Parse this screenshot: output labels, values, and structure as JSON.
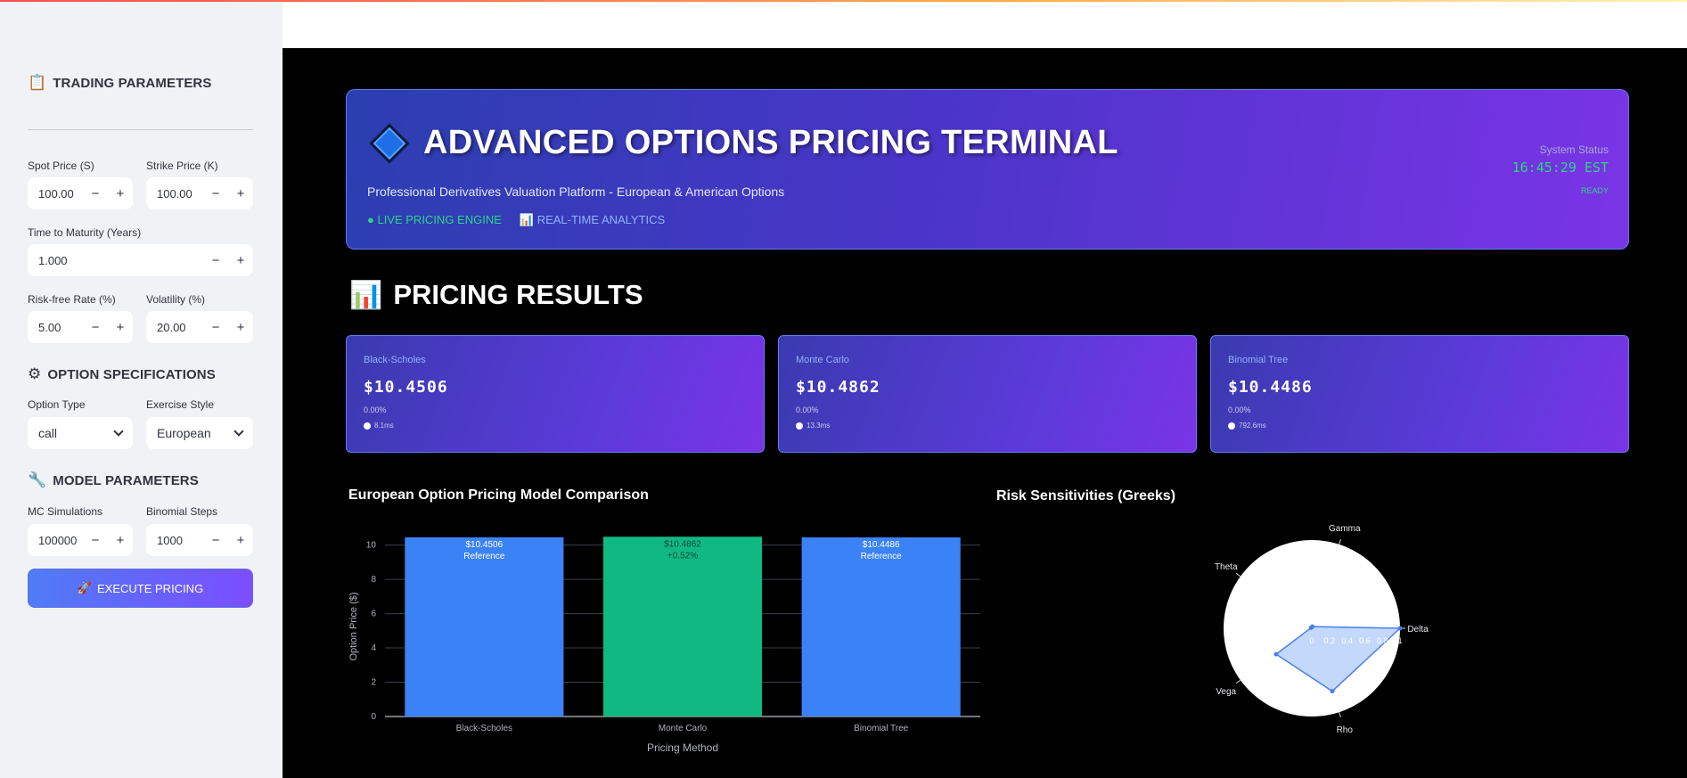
{
  "sidebar": {
    "trading_header": "TRADING PARAMETERS",
    "trading_icon": "clipboard-icon",
    "spot_label": "Spot Price (S)",
    "spot_value": "100.00",
    "strike_label": "Strike Price (K)",
    "strike_value": "100.00",
    "maturity_label": "Time to Maturity (Years)",
    "maturity_value": "1.000",
    "rate_label": "Risk-free Rate (%)",
    "rate_value": "5.00",
    "vol_label": "Volatility (%)",
    "vol_value": "20.00",
    "option_spec_header": "OPTION SPECIFICATIONS",
    "option_spec_icon": "gear-icon",
    "option_type_label": "Option Type",
    "option_type_value": "call",
    "exercise_label": "Exercise Style",
    "exercise_value": "European",
    "model_header": "MODEL PARAMETERS",
    "model_icon": "wrench-icon",
    "mc_label": "MC Simulations",
    "mc_value": "100000",
    "binom_label": "Binomial Steps",
    "binom_value": "1000",
    "minus": "−",
    "plus": "+",
    "execute_label": "EXECUTE PRICING",
    "execute_icon": "rocket-icon"
  },
  "hero": {
    "title": "ADVANCED OPTIONS PRICING TERMINAL",
    "subtitle": "Professional Derivatives Valuation Platform - European & American Options",
    "tag_live": "● LIVE PRICING ENGINE",
    "tag_analytics": "REAL-TIME ANALYTICS",
    "status_label": "System Status",
    "status_time": "16:45:29 EST",
    "status_state": "READY"
  },
  "results": {
    "title": "PRICING RESULTS",
    "cards": [
      {
        "name": "Black-Scholes",
        "price": "$10.4506",
        "pct": "0.00%",
        "time": "8.1ms"
      },
      {
        "name": "Monte Carlo",
        "price": "$10.4862",
        "pct": "0.00%",
        "time": "13.3ms"
      },
      {
        "name": "Binomial Tree",
        "price": "$10.4486",
        "pct": "0.00%",
        "time": "792.6ms"
      }
    ]
  },
  "colors": {
    "bar_blue": "#3b82f6",
    "bar_green": "#10b981",
    "radar_fill": "#bcd4fb",
    "radar_line": "#4a7fe6"
  },
  "chart_data": [
    {
      "type": "bar",
      "title": "European Option Pricing Model Comparison",
      "categories": [
        "Black-Scholes",
        "Monte Carlo",
        "Binomial Tree"
      ],
      "values": [
        10.4506,
        10.4862,
        10.4486
      ],
      "bar_labels": [
        [
          "$10.4506",
          "Reference"
        ],
        [
          "$10.4862",
          "+0.52%"
        ],
        [
          "$10.4486",
          "Reference"
        ]
      ],
      "xlabel": "Pricing Method",
      "ylabel": "Option Price ($)",
      "ylim": [
        0,
        10.5
      ],
      "yticks": [
        0,
        2,
        4,
        6,
        8,
        10
      ],
      "grid": true
    },
    {
      "type": "radar",
      "title": "Risk Sensitivities (Greeks)",
      "axes": [
        "Delta",
        "Gamma",
        "Theta",
        "Vega",
        "Rho"
      ],
      "values": [
        1.0,
        0.02,
        0.01,
        0.5,
        0.75
      ],
      "radial_ticks": [
        "0",
        "0.2",
        "0.4",
        "0.6",
        "0.8",
        "1"
      ],
      "range": [
        0,
        1
      ]
    }
  ]
}
